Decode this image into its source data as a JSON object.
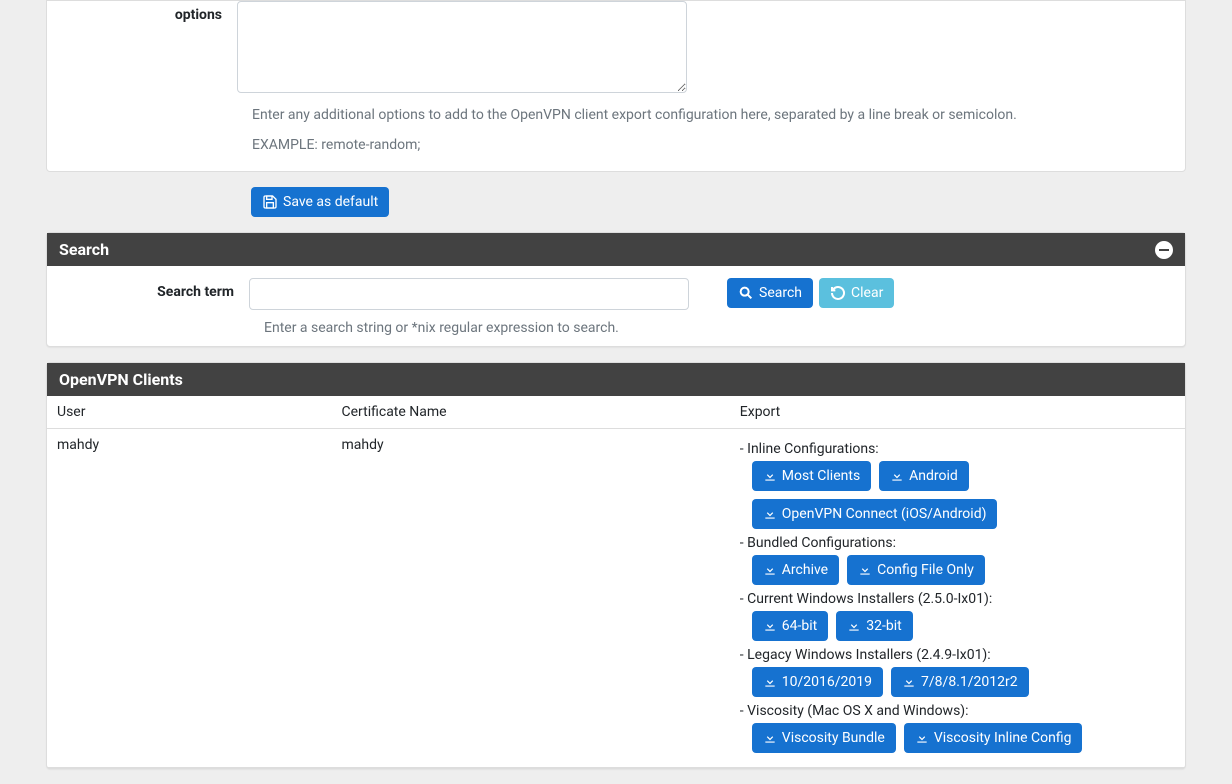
{
  "options_panel": {
    "label": "options",
    "textarea_value": "",
    "help1": "Enter any additional options to add to the OpenVPN client export configuration here, separated by a line break or semicolon.",
    "help2": "EXAMPLE: remote-random;",
    "save_label": "Save as default"
  },
  "search_panel": {
    "title": "Search",
    "term_label": "Search term",
    "input_value": "",
    "search_btn": "Search",
    "clear_btn": "Clear",
    "help": "Enter a search string or *nix regular expression to search."
  },
  "clients_panel": {
    "title": "OpenVPN Clients",
    "columns": {
      "user": "User",
      "cert": "Certificate Name",
      "export": "Export"
    },
    "rows": [
      {
        "user": "mahdy",
        "cert": "mahdy",
        "export": {
          "inline_label": "Inline Configurations:",
          "inline_buttons": [
            "Most Clients",
            "Android",
            "OpenVPN Connect (iOS/Android)"
          ],
          "bundled_label": "Bundled Configurations:",
          "bundled_buttons": [
            "Archive",
            "Config File Only"
          ],
          "current_win_label": "Current Windows Installers (2.5.0-Ix01):",
          "current_win_buttons": [
            "64-bit",
            "32-bit"
          ],
          "legacy_win_label": "Legacy Windows Installers (2.4.9-Ix01):",
          "legacy_win_buttons": [
            "10/2016/2019",
            "7/8/8.1/2012r2"
          ],
          "viscosity_label": "Viscosity (Mac OS X and Windows):",
          "viscosity_buttons": [
            "Viscosity Bundle",
            "Viscosity Inline Config"
          ]
        }
      }
    ]
  }
}
